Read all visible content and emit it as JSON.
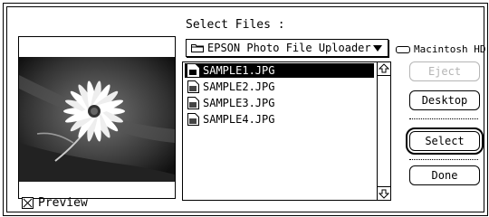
{
  "dialog": {
    "select_label": "Select Files :",
    "folder_popup": "EPSON Photo File Uploader",
    "volume": "Macintosh HD",
    "preview_label": "Preview",
    "files": [
      "SAMPLE1.JPG",
      "SAMPLE2.JPG",
      "SAMPLE3.JPG",
      "SAMPLE4.JPG"
    ],
    "selected_file_index": 0,
    "buttons": {
      "eject": "Eject",
      "desktop": "Desktop",
      "select": "Select",
      "done": "Done"
    }
  },
  "colors": {
    "selection_bg": "#000000",
    "selection_text": "#ffffff",
    "disabled": "#b5b5b5"
  },
  "icons": {
    "folder": "folder-icon",
    "file": "document-icon",
    "disk": "disk-icon",
    "popup_arrow": "chevron-down-icon",
    "scroll_up": "scroll-up-icon",
    "scroll_down": "scroll-down-icon"
  }
}
